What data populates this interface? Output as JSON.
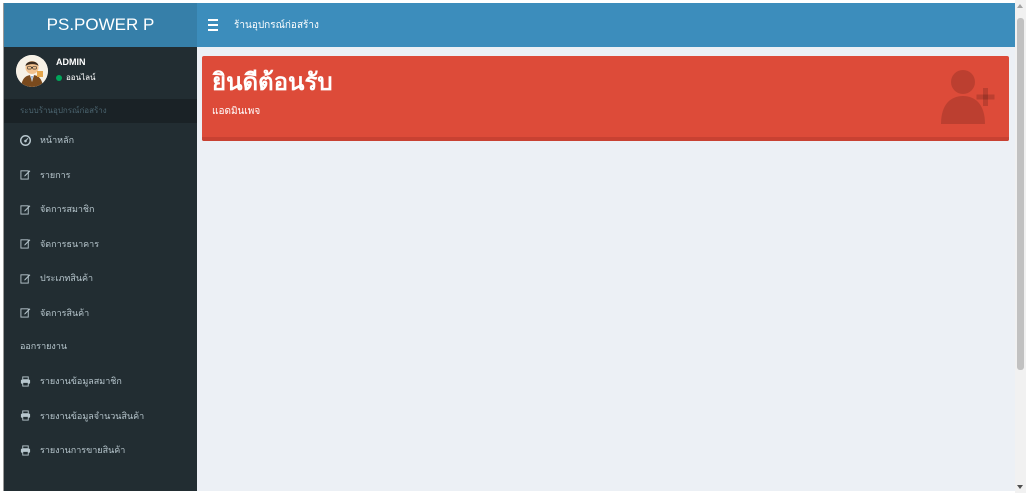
{
  "brand": "PS.POWER P",
  "navbar": {
    "title": "ร้านอุปกรณ์ก่อสร้าง",
    "toggle_icon": "hamburger-icon"
  },
  "user": {
    "name": "ADMIN",
    "status": "ออนไลน์",
    "status_color": "#00a65a"
  },
  "sidebar": {
    "header": "ระบบร้านอุปกรณ์ก่อสร้าง",
    "items": [
      {
        "label": "หน้าหลัก",
        "icon": "dashboard-icon"
      },
      {
        "label": "รายการ",
        "icon": "edit-icon"
      },
      {
        "label": "จัดการสมาชิก",
        "icon": "edit-icon"
      },
      {
        "label": "จัดการธนาคาร",
        "icon": "edit-icon"
      },
      {
        "label": "ประเภทสินค้า",
        "icon": "edit-icon"
      },
      {
        "label": "จัดการสินค้า",
        "icon": "edit-icon"
      }
    ],
    "report_section": "ออกรายงาน",
    "reports": [
      {
        "label": "รายงานข้อมูลสมาชิก",
        "icon": "print-icon"
      },
      {
        "label": "รายงานข้อมูลจำนวนสินค้า",
        "icon": "print-icon"
      },
      {
        "label": "รายงานการขายสินค้า",
        "icon": "print-icon"
      }
    ]
  },
  "welcome": {
    "title": "ยินดีต้อนรับ",
    "subtitle": "แอดมินเพจ",
    "icon": "user-plus-icon",
    "color": "#dd4b39"
  },
  "colors": {
    "header": "#3c8dbc",
    "logo": "#367fa9",
    "sidebar": "#222d32",
    "content": "#ecf0f5"
  }
}
